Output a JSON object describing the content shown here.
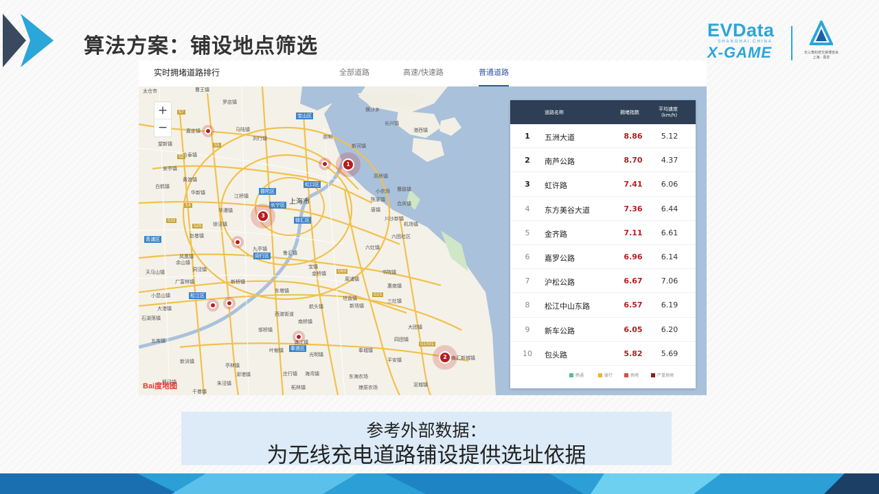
{
  "slide": {
    "title": "算法方案：铺设地点筛选",
    "brand_line1": "EVData",
    "brand_line2": "SHANGHAI CHINA",
    "brand_line3": "X-GAME",
    "org_caption": "长三角科技交易博览会",
    "org_subcaption": "上海 · 嘉定",
    "caption_line1": "参考外部数据：",
    "caption_line2": "为无线充电道路铺设提供选址依据",
    "accent_color": "#2ba6d8",
    "arrow_colors": [
      "#3a4a5e",
      "#2ba6d8"
    ]
  },
  "panel": {
    "title": "实时拥堵道路排行",
    "tabs": [
      {
        "label": "全部道路",
        "active": false
      },
      {
        "label": "高速/快速路",
        "active": false
      },
      {
        "label": "普通道路",
        "active": true
      }
    ],
    "active_tab_color": "#2f55a4"
  },
  "map": {
    "zoom_in": "+",
    "zoom_out": "−",
    "city_label": "上海市",
    "baidu_logo": "Bai度地图",
    "districts": [
      "宝山区",
      "普陀区",
      "虹口区",
      "长宁区",
      "徐汇区",
      "闵行区",
      "松江区",
      "奉贤区",
      "青浦区"
    ],
    "places": [
      "太仓市",
      "曹王镇",
      "罗店镇",
      "马陆镇",
      "嘉定镇",
      "刘行镇",
      "望新镇",
      "方泰镇",
      "安亭镇",
      "黄渡镇",
      "白鹤镇",
      "华新镇",
      "江桥镇",
      "华漕镇",
      "徐泾镇",
      "赵巷镇",
      "九亭镇",
      "凤凰镇",
      "余山镇",
      "天马山镇",
      "广富林镇",
      "洞泾镇",
      "小昆山镇",
      "新桥镇",
      "大港镇",
      "石湖荡镇",
      "五库镇",
      "新浜镇",
      "叶榭镇",
      "亭林镇",
      "朱泾镇",
      "千巷镇",
      "枫泾镇",
      "泖港镇",
      "车墩镇",
      "西渡街道",
      "邬桥镇",
      "南桥镇",
      "光明镇",
      "奉城镇",
      "庄行镇",
      "柘林镇",
      "四团镇",
      "平安镇",
      "大团镇",
      "三灶镇",
      "新场镇",
      "周浦镇",
      "川沙新镇",
      "机场镇",
      "六团社区",
      "合庆镇",
      "唐镇",
      "高桥镇",
      "曹路镇",
      "横沙乡",
      "长兴镇",
      "崇明",
      "新河镇",
      "港西镇",
      "小农场",
      "陈家镇",
      "宝镇",
      "金桥镇",
      "浦江镇",
      "鲁汇镇",
      "航头镇",
      "坦直镇",
      "惠南镇",
      "六灶镇",
      "南汇新城镇",
      "书院镇",
      "泥城镇",
      "东海农场",
      "海湾镇",
      "燎原农场"
    ],
    "road_numbers": [
      "S7",
      "S5",
      "S2",
      "S4",
      "S32",
      "S20",
      "G60",
      "G15",
      "G1501"
    ],
    "markers": [
      {
        "label": "1"
      },
      {
        "label": "2"
      },
      {
        "label": "3"
      }
    ]
  },
  "ranking": {
    "header": {
      "rank": "",
      "name": "道路名称",
      "index": "拥堵指数",
      "speed_line1": "平均速度",
      "speed_line2": "(km/h)"
    },
    "rows": [
      {
        "rank": "1",
        "name": "五洲大道",
        "index": "8.86",
        "speed": "5.12"
      },
      {
        "rank": "2",
        "name": "南芦公路",
        "index": "8.70",
        "speed": "4.37"
      },
      {
        "rank": "3",
        "name": "虹许路",
        "index": "7.41",
        "speed": "6.06"
      },
      {
        "rank": "4",
        "name": "东方美谷大道",
        "index": "7.36",
        "speed": "6.44"
      },
      {
        "rank": "5",
        "name": "金齐路",
        "index": "7.11",
        "speed": "6.61"
      },
      {
        "rank": "6",
        "name": "嘉罗公路",
        "index": "6.96",
        "speed": "6.14"
      },
      {
        "rank": "7",
        "name": "沪松公路",
        "index": "6.67",
        "speed": "7.06"
      },
      {
        "rank": "8",
        "name": "松江中山东路",
        "index": "6.57",
        "speed": "6.19"
      },
      {
        "rank": "9",
        "name": "新车公路",
        "index": "6.05",
        "speed": "6.20"
      },
      {
        "rank": "10",
        "name": "包头路",
        "index": "5.82",
        "speed": "5.69"
      }
    ],
    "legend": [
      {
        "label": "畅通",
        "color": "#4fc08d"
      },
      {
        "label": "缓行",
        "color": "#f0b429"
      },
      {
        "label": "拥堵",
        "color": "#e04a3a"
      },
      {
        "label": "严重拥堵",
        "color": "#8b1c1c"
      }
    ],
    "header_color": "#2d3e55",
    "index_color": "#b21f1f"
  }
}
